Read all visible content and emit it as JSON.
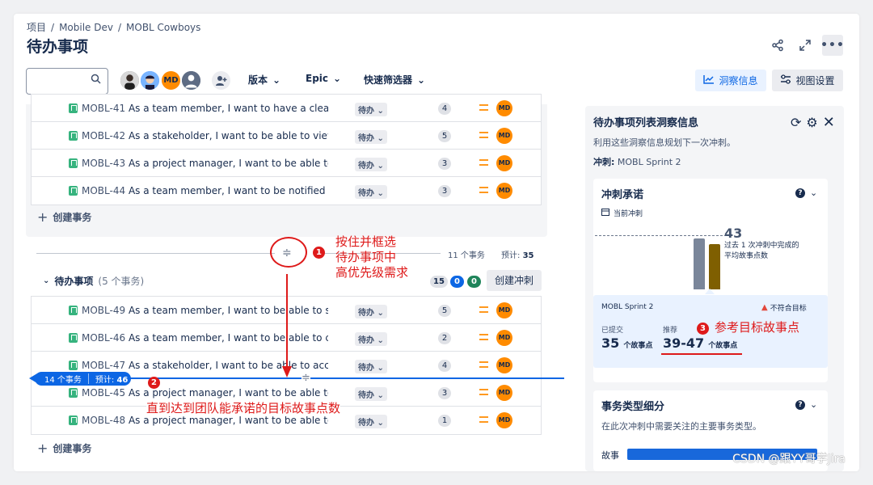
{
  "breadcrumb": {
    "items": [
      "项目",
      "Mobile Dev",
      "MOBL Cowboys"
    ],
    "separator": "/"
  },
  "page": {
    "title": "待办事项"
  },
  "toolbar": {
    "search_placeholder": "",
    "avatar_initials": "MD",
    "filters": [
      "版本",
      "Epic",
      "快速筛选器"
    ],
    "insight_label": "洞察信息",
    "view_settings_label": "视图设置"
  },
  "sprint_issues": [
    {
      "key": "MOBL-41",
      "summary": "As a team member, I want to have a clear o...",
      "status": "待办",
      "points": "4",
      "assignee": "MD"
    },
    {
      "key": "MOBL-42",
      "summary": "As a stakeholder, I want to be able to view t...",
      "status": "待办",
      "points": "5",
      "assignee": "MD"
    },
    {
      "key": "MOBL-43",
      "summary": "As a project manager, I want to be able to s...",
      "status": "待办",
      "points": "3",
      "assignee": "MD"
    },
    {
      "key": "MOBL-44",
      "summary": "As a team member, I want to be notified wh...",
      "status": "待办",
      "points": "3",
      "assignee": "MD"
    }
  ],
  "create_issue_label": "创建事务",
  "divider": {
    "issues_count": "11 个事务",
    "estimate_label": "预计:",
    "estimate_value": "35"
  },
  "backlog": {
    "title": "待办事项",
    "count_text": "(5 个事务)",
    "status_counts": [
      "15",
      "0",
      "0"
    ],
    "create_sprint_label": "创建冲刺",
    "issues": [
      {
        "key": "MOBL-49",
        "summary": "As a team member, I want to be able to see...",
        "status": "待办",
        "points": "5",
        "assignee": "MD"
      },
      {
        "key": "MOBL-46",
        "summary": "As a team member, I want to be able to coll...",
        "status": "待办",
        "points": "2",
        "assignee": "MD"
      },
      {
        "key": "MOBL-47",
        "summary": "As a stakeholder, I want to be able to acces...",
        "status": "待办",
        "points": "4",
        "assignee": "MD"
      },
      {
        "key": "MOBL-45",
        "summary": "As a project manager, I want to be able to ...",
        "status": "待办",
        "points": "3",
        "assignee": "MD"
      },
      {
        "key": "MOBL-48",
        "summary": "As a project manager, I want to be able to t...",
        "status": "待办",
        "points": "1",
        "assignee": "MD"
      }
    ]
  },
  "drag_marker": {
    "issues_text": "14 个事务",
    "estimate_label": "预计:",
    "estimate_value": "46"
  },
  "annotations": {
    "num1": "1",
    "text1": [
      "按住并框选",
      "待办事项中",
      "高优先级需求"
    ],
    "num2": "2",
    "text2": "直到达到团队能承诺的目标故事点数",
    "num3": "3",
    "text3": "参考目标故事点"
  },
  "insights_panel": {
    "title": "待办事项列表洞察信息",
    "subtitle": "利用这些洞察信息规划下一次冲刺。",
    "sprint_label": "冲刺:",
    "sprint_name": "MOBL Sprint 2",
    "commitment": {
      "title": "冲刺承诺",
      "current_sprint_label": "当前冲刺",
      "avg_value": "43",
      "avg_desc": [
        "过去 1 次冲刺中完成的",
        "平均故事点数"
      ],
      "bars": [
        {
          "name": "committed",
          "value": 43,
          "color": "#7a869a"
        },
        {
          "name": "completed",
          "value": 38,
          "color": "#7f5f01"
        }
      ],
      "summary": {
        "sprint_name": "MOBL Sprint 2",
        "warning": "不符合目标",
        "submitted_label": "已提交",
        "submitted_value": "35",
        "submitted_unit": "个故事点",
        "recommended_label": "推荐",
        "recommended_value": "39-47",
        "recommended_unit": "个故事点"
      }
    },
    "issue_types": {
      "title": "事务类型细分",
      "desc": "在此次冲刺中需要关注的主要事务类型。",
      "row_label": "故事"
    }
  },
  "watermark": "CSDN @跟YY哥学Jira",
  "colors": {
    "accent": "#0c66e4",
    "annotation": "#de1a1a",
    "assignee": "#ff8b00",
    "story": "#36b37e"
  }
}
